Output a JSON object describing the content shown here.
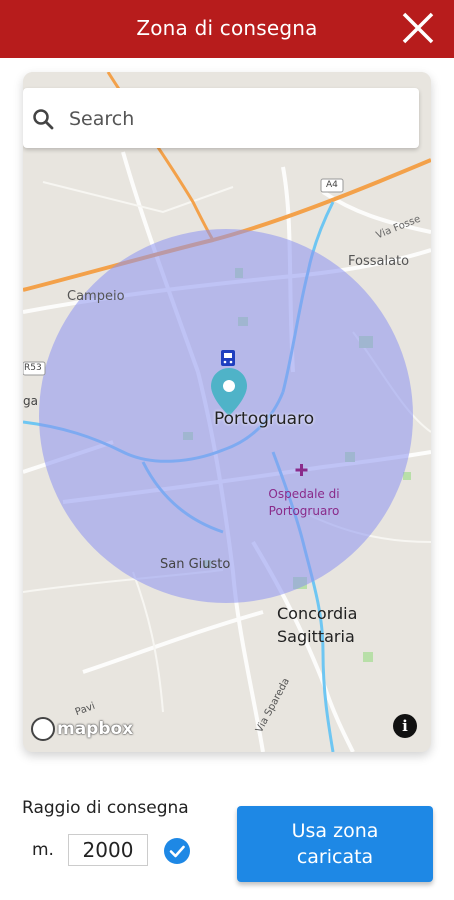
{
  "header": {
    "title": "Zona di consegna",
    "background_color": "#b71c1c"
  },
  "map": {
    "search": {
      "placeholder": "Search"
    },
    "labels": {
      "campeio": "Campeio",
      "fossalato": "Fossalato",
      "via_fosse": "Via Fosse",
      "portogruaro": "Portogruaro",
      "ospedale": "Ospedale di Portogruaro",
      "san_giusto": "San Giusto",
      "concordia": "Concordia Sagittaria",
      "via_spareda": "Via Spareda",
      "road_a4": "A4",
      "road_r53": "R53",
      "road_cut": "ga",
      "road_cut2": "Pavi"
    },
    "attribution": "mapbox",
    "zone_color": "#8c93f0",
    "marker_color": "#4fb3c8"
  },
  "form": {
    "radius_label": "Raggio di consegna",
    "unit": "m.",
    "radius_value": "2000",
    "confirmed": true,
    "use_button": "Usa zona caricata",
    "accent_color": "#1e88e5"
  }
}
